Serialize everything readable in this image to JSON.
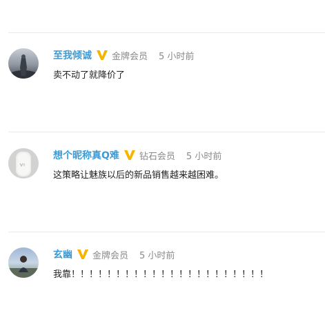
{
  "comments": [
    {
      "username": "至我倾诚",
      "badge_icon": "vip-v-icon",
      "level": "金牌会员",
      "time": "5 小时前",
      "content": "卖不动了就降价了"
    },
    {
      "username": "想个昵称真Q难",
      "badge_icon": "vip-v-icon",
      "level": "钻石会员",
      "time": "5 小时前",
      "content": "这策略让魅族以后的新品销售越来越困难。"
    },
    {
      "username": "玄幽",
      "badge_icon": "vip-v-icon",
      "level": "金牌会员",
      "time": "5 小时前",
      "content": "我靠！！！！！！！！！！！！！！！！！！！！！！"
    }
  ],
  "colors": {
    "username": "#3c9bd6",
    "badge": "#f5b400",
    "meta_text": "#8a8a8a",
    "content_text": "#222222",
    "divider": "#e9e9e9"
  }
}
